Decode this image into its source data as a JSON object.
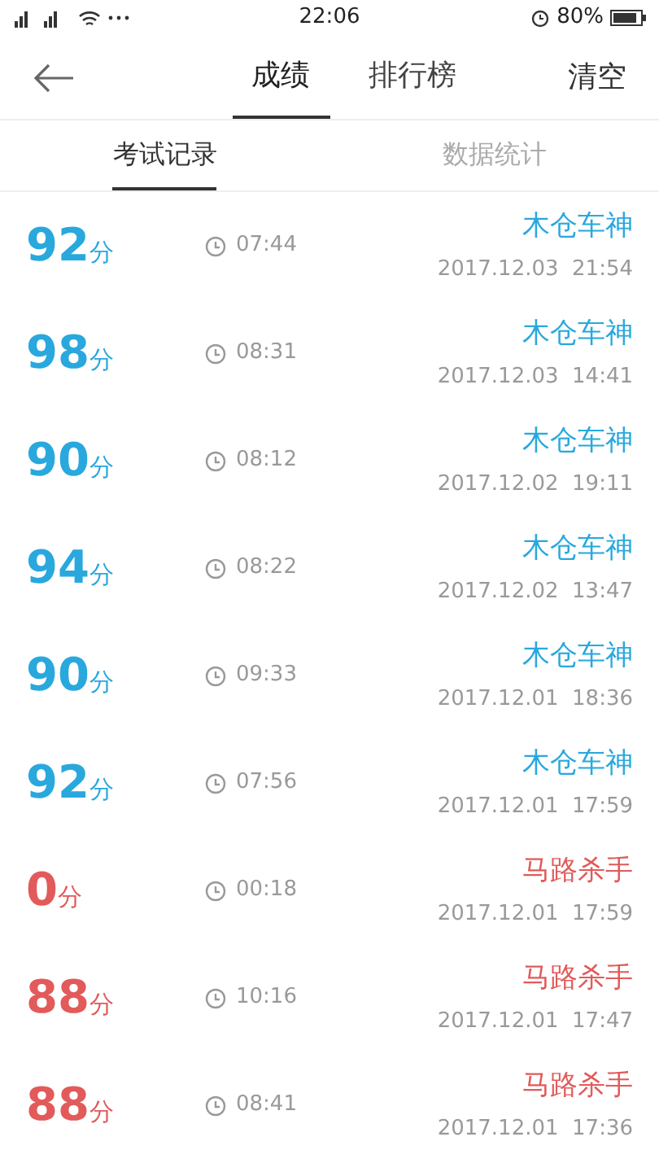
{
  "status_bar": {
    "time": "22:06",
    "battery": "80%"
  },
  "nav": {
    "tabs": [
      {
        "label": "成绩",
        "selected": true
      },
      {
        "label": "排行榜",
        "selected": false
      }
    ],
    "action": "清空"
  },
  "sub_tabs": [
    {
      "label": "考试记录",
      "selected": true
    },
    {
      "label": "数据统计",
      "selected": false
    }
  ],
  "records": [
    {
      "score": "92",
      "unit": "分",
      "duration": "07:44",
      "title": "木仓车神",
      "date": "2017.12.03  21:54",
      "color": "#29a8dd"
    },
    {
      "score": "98",
      "unit": "分",
      "duration": "08:31",
      "title": "木仓车神",
      "date": "2017.12.03  14:41",
      "color": "#29a8dd"
    },
    {
      "score": "90",
      "unit": "分",
      "duration": "08:12",
      "title": "木仓车神",
      "date": "2017.12.02  19:11",
      "color": "#29a8dd"
    },
    {
      "score": "94",
      "unit": "分",
      "duration": "08:22",
      "title": "木仓车神",
      "date": "2017.12.02  13:47",
      "color": "#29a8dd"
    },
    {
      "score": "90",
      "unit": "分",
      "duration": "09:33",
      "title": "木仓车神",
      "date": "2017.12.01  18:36",
      "color": "#29a8dd"
    },
    {
      "score": "92",
      "unit": "分",
      "duration": "07:56",
      "title": "木仓车神",
      "date": "2017.12.01  17:59",
      "color": "#29a8dd"
    },
    {
      "score": "0",
      "unit": "分",
      "duration": "00:18",
      "title": "马路杀手",
      "date": "2017.12.01  17:59",
      "color": "#e25a5a"
    },
    {
      "score": "88",
      "unit": "分",
      "duration": "10:16",
      "title": "马路杀手",
      "date": "2017.12.01  17:47",
      "color": "#e25a5a"
    },
    {
      "score": "88",
      "unit": "分",
      "duration": "08:41",
      "title": "马路杀手",
      "date": "2017.12.01  17:36",
      "color": "#e25a5a"
    }
  ]
}
